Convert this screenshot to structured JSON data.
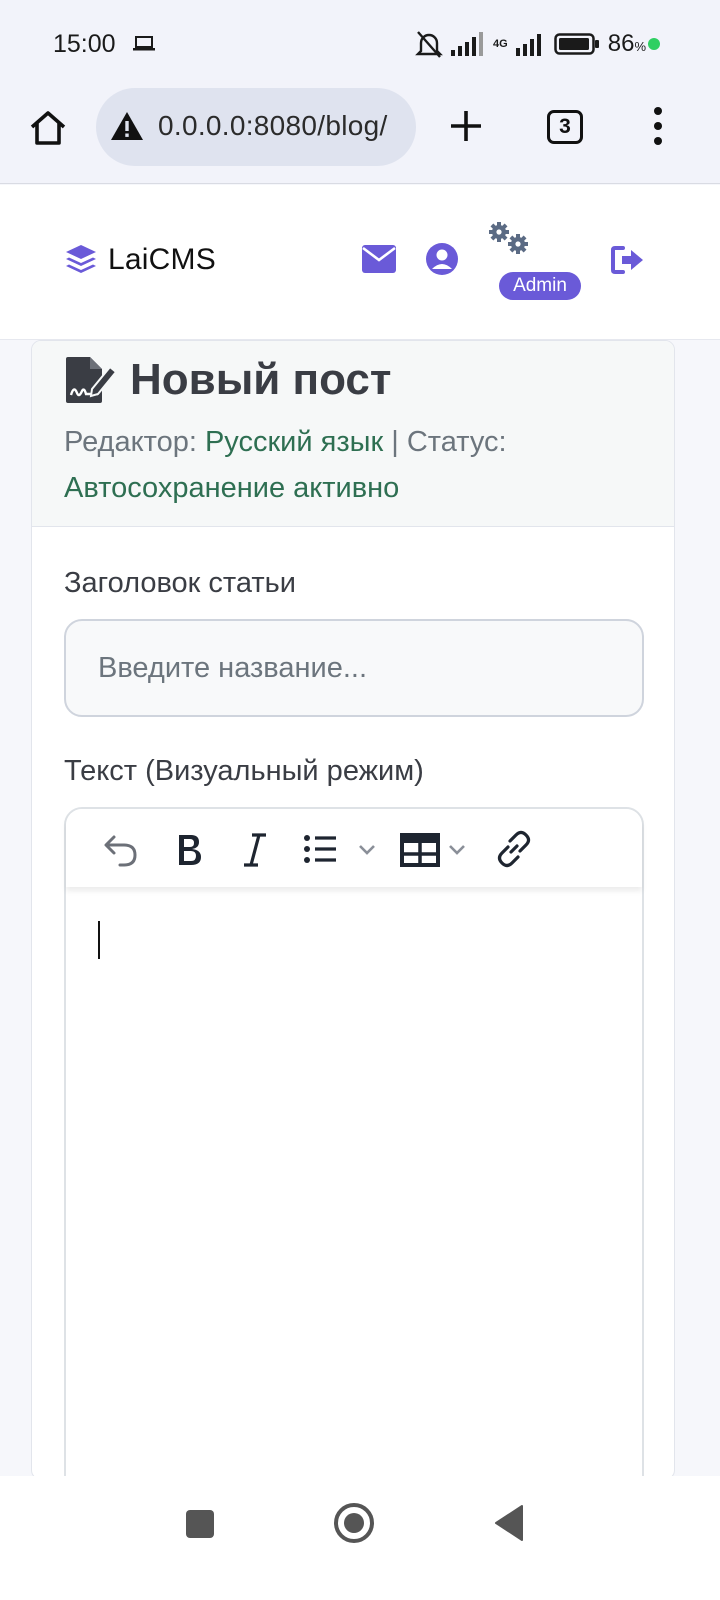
{
  "status_bar": {
    "time": "15:00",
    "battery_percent": "86",
    "battery_unit": "%",
    "network": "4G"
  },
  "browser": {
    "url": "0.0.0.0:8080/blog/",
    "tab_count": "3"
  },
  "navbar": {
    "brand": "LaiCMS",
    "admin_badge": "Admin",
    "icons": [
      "layer-group-icon",
      "envelope-icon",
      "user-circle-icon",
      "gears-icon",
      "logout-icon"
    ],
    "accent_color": "#6a5ad8"
  },
  "card": {
    "title": "Новый пост",
    "meta_editor_label": "Редактор:",
    "meta_editor_value": "Русский язык",
    "meta_separator": " | ",
    "meta_status_label": "Статус:",
    "meta_status_value": "Автосохранение активно",
    "accent_text_color": "#2e6f52"
  },
  "form": {
    "title_label": "Заголовок статьи",
    "title_placeholder": "Введите название...",
    "title_value": "",
    "body_label": "Текст (Визуальный режим)",
    "toolbar": [
      "undo-icon",
      "bold-icon",
      "italic-icon",
      "bullet-list-icon",
      "table-icon",
      "link-icon"
    ]
  }
}
